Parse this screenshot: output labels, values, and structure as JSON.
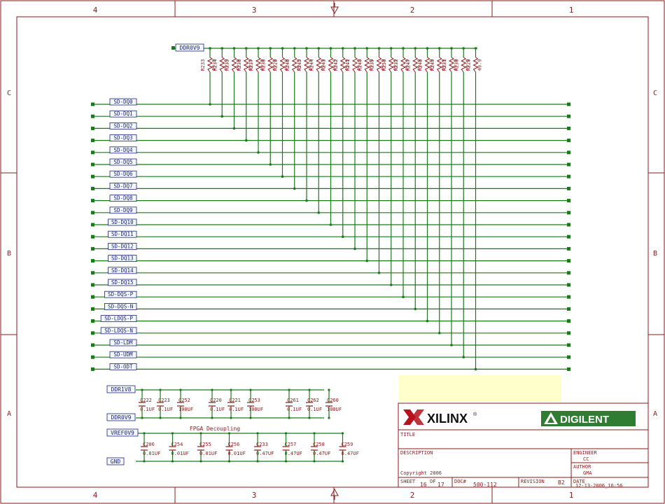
{
  "frame": {
    "zones_top": [
      "4",
      "3",
      "2",
      "1"
    ],
    "zones_side": [
      "C",
      "B",
      "A"
    ],
    "colors": {
      "border": "#8b1a1a",
      "wire": "#1a7a1a",
      "port_fill": "#f4f8ff",
      "port_stroke": "#1a237e",
      "port_text": "#1a237e",
      "part_text": "#8b1a1a",
      "pin": "#1a7a1a",
      "note_fill": "#ffffcc"
    }
  },
  "top_net": "DDR0V9",
  "resistors": [
    {
      "ref": "R233",
      "val": "49.9"
    },
    {
      "ref": "R234",
      "val": "49.9"
    },
    {
      "ref": "R235",
      "val": "49.9"
    },
    {
      "ref": "R236",
      "val": "49.9"
    },
    {
      "ref": "R237",
      "val": "49.9"
    },
    {
      "ref": "R238",
      "val": "49.9"
    },
    {
      "ref": "R228",
      "val": "49.9"
    },
    {
      "ref": "R246",
      "val": "49.9"
    },
    {
      "ref": "R245",
      "val": "49.9"
    },
    {
      "ref": "R244",
      "val": "49.9"
    },
    {
      "ref": "R243",
      "val": "49.9"
    },
    {
      "ref": "R242",
      "val": "49.9"
    },
    {
      "ref": "R241",
      "val": "49.9"
    },
    {
      "ref": "R240",
      "val": "49.9"
    },
    {
      "ref": "R239",
      "val": "49.9"
    },
    {
      "ref": "R250",
      "val": "49.9"
    },
    {
      "ref": "R232",
      "val": "49.9"
    },
    {
      "ref": "R247",
      "val": "49.9"
    },
    {
      "ref": "R248",
      "val": "49.9"
    },
    {
      "ref": "R249",
      "val": "49.9"
    },
    {
      "ref": "R231",
      "val": "49.9"
    },
    {
      "ref": "R230",
      "val": "49.9"
    },
    {
      "ref": "R229",
      "val": "49.9"
    }
  ],
  "signals": [
    "SD-DQ0",
    "SD-DQ1",
    "SD-DQ2",
    "SD-DQ3",
    "SD-DQ4",
    "SD-DQ5",
    "SD-DQ6",
    "SD-DQ7",
    "SD-DQ8",
    "SD-DQ9",
    "SD-DQ10",
    "SD-DQ11",
    "SD-DQ12",
    "SD-DQ13",
    "SD-DQ14",
    "SD-DQ15",
    "SD-DQS-P",
    "SD-DQS-N",
    "SD-LDQS-P",
    "SD-LDQS-N",
    "SD-LDM",
    "SD-UDM",
    "SD-ODT"
  ],
  "decoupling": {
    "net_top": "DDR1V8",
    "net_bot": "DDR0V9",
    "net_vref": "VREF0V9",
    "net_gnd": "GND",
    "group1": [
      {
        "ref": "C222",
        "val": "0.1UF"
      },
      {
        "ref": "C223",
        "val": "0.1UF"
      },
      {
        "ref": "C252",
        "val": "100UF"
      },
      {
        "ref": "C220",
        "val": "0.1UF"
      },
      {
        "ref": "C221",
        "val": "0.1UF"
      },
      {
        "ref": "C253",
        "val": "100UF"
      },
      {
        "ref": "C261",
        "val": "0.1UF"
      },
      {
        "ref": "C262",
        "val": "0.1UF"
      },
      {
        "ref": "C260",
        "val": "100UF"
      }
    ],
    "group2_title": "FPGA Decoupling",
    "group2": [
      {
        "ref": "C206",
        "val": "0.01UF"
      },
      {
        "ref": "C254",
        "val": "0.01UF"
      },
      {
        "ref": "C255",
        "val": "0.01UF"
      },
      {
        "ref": "C256",
        "val": "0.01UF"
      },
      {
        "ref": "C233",
        "val": "0.47UF"
      },
      {
        "ref": "C257",
        "val": "0.47UF"
      },
      {
        "ref": "C258",
        "val": "0.47UF"
      },
      {
        "ref": "C259",
        "val": "0.47UF"
      }
    ]
  },
  "title_block": {
    "logo_left": "XILINX",
    "logo_left_mark": "®",
    "logo_right": "DIGILENT",
    "title_label": "TITLE",
    "title_value": "",
    "description_label": "DESCRIPTION",
    "copyright": "Copyright 2006",
    "engineer_label": "ENGINEER",
    "engineer_value": "CC",
    "author_label": "AUTHOR",
    "author_value": "GMA",
    "sheet_label": "SHEET",
    "of_label": "OF",
    "sheet_num": "16",
    "sheet_total": "17",
    "doc_label": "DOC#",
    "doc_value": "500-112",
    "revision_label": "REVISION",
    "revision_value": "B2",
    "date_label": "DATE",
    "date_value": "12-13-2006_16:56"
  }
}
